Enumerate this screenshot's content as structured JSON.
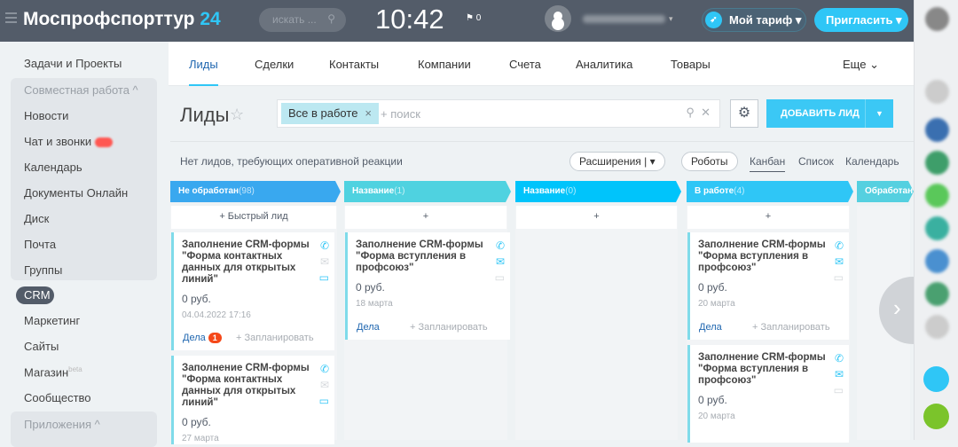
{
  "header": {
    "logo_name": "Моспрофспорттур",
    "logo_num": "24",
    "search_placeholder": "искать ...",
    "clock": "10:42",
    "flag_count": "0",
    "tarif": "Мой тариф",
    "invite": "Пригласить"
  },
  "sidebar": {
    "items": [
      "Задачи и Проекты",
      "Совместная работа ^",
      "Новости",
      "Чат и звонки",
      "Календарь",
      "Документы Онлайн",
      "Диск",
      "Почта",
      "Группы",
      "CRM",
      "Маркетинг",
      "Сайты",
      "Магазин",
      "Сообщество",
      "Приложения ^"
    ],
    "beta": "beta"
  },
  "tabs": [
    "Лиды",
    "Сделки",
    "Контакты",
    "Компании",
    "Счета",
    "Аналитика",
    "Товары",
    "Еще ⌄"
  ],
  "page": {
    "title": "Лиды",
    "filter_chip": "Все в работе",
    "filter_placeholder": "+ поиск",
    "add_button": "ДОБАВИТЬ ЛИД",
    "note": "Нет лидов, требующих оперативной реакции",
    "extensions": "Расширения  |  ▾",
    "robots": "Роботы",
    "views": [
      "Канбан",
      "Список",
      "Календарь"
    ]
  },
  "columns": [
    {
      "name": "Не обработан",
      "count": "(98)",
      "color": "#39a8ef",
      "quick": "+ Быстрый лид"
    },
    {
      "name": "Название",
      "count": "(1)",
      "color": "#4fd2e0",
      "quick": "+"
    },
    {
      "name": "Название",
      "count": "(0)",
      "color": "#00c4fb",
      "quick": "+"
    },
    {
      "name": "В работе",
      "count": "(4)",
      "color": "#2fc6f6",
      "quick": "+"
    },
    {
      "name": "Обработан",
      "count": "",
      "color": "#55d0e0",
      "quick": ""
    }
  ],
  "cards": [
    {
      "col": 0,
      "title": "Заполнение CRM-формы \"Форма контактных данных для открытых линий\"",
      "price": "0 руб.",
      "date": "04.04.2022 17:16",
      "deals": "Дела",
      "deals_badge": "1",
      "plan": "+ Запланировать"
    },
    {
      "col": 0,
      "title": "Заполнение CRM-формы \"Форма контактных данных для открытых линий\"",
      "price": "0 руб.",
      "date": "27 марта",
      "deals": "",
      "deals_badge": "",
      "plan": ""
    },
    {
      "col": 1,
      "title": "Заполнение CRM-формы \"Форма вступления в профсоюз\"",
      "price": "0 руб.",
      "date": "18 марта",
      "deals": "Дела",
      "deals_badge": "",
      "plan": "+ Запланировать"
    },
    {
      "col": 3,
      "title": "Заполнение CRM-формы \"Форма вступления в профсоюз\"",
      "price": "0 руб.",
      "date": "20 марта",
      "deals": "Дела",
      "deals_badge": "",
      "plan": "+ Запланировать"
    },
    {
      "col": 3,
      "title": "Заполнение CRM-формы \"Форма вступления в профсоюз\"",
      "price": "0 руб.",
      "date": "20 марта",
      "deals": "",
      "deals_badge": "",
      "plan": ""
    }
  ]
}
